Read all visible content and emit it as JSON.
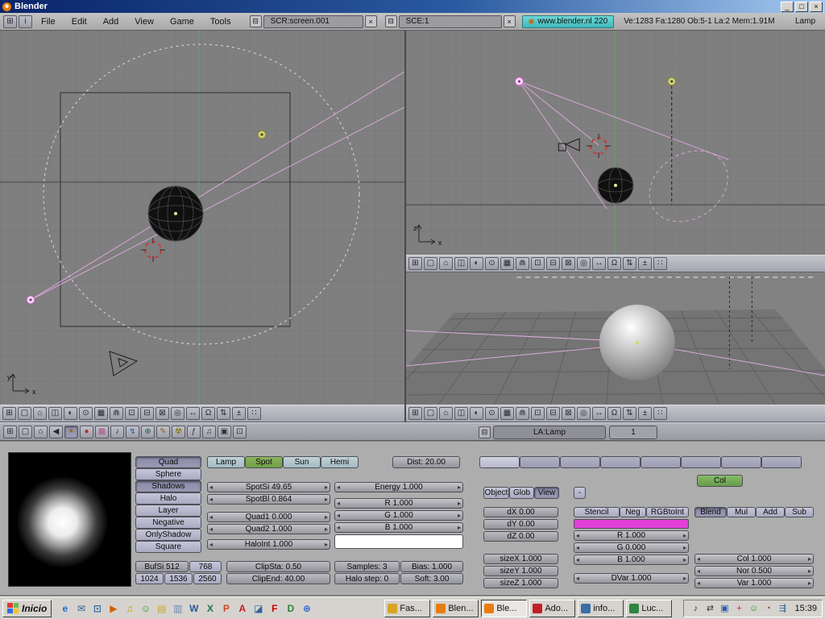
{
  "titlebar": {
    "title": "Blender"
  },
  "window_controls": {
    "minimize": "_",
    "maximize": "□",
    "close": "×"
  },
  "menubar": {
    "menus": [
      "File",
      "Edit",
      "Add",
      "View",
      "Game",
      "Tools"
    ],
    "collapse_glyph": "⊟",
    "screen_field": "SCR:screen.001",
    "scene_field": "SCE:1",
    "close_x": "×",
    "link_icon_glyph": "◉",
    "link_label": "www.blender.nl 220",
    "stats": "Ve:1283 Fa:1280 Ob:5-1 La:2 Mem:1.91M",
    "active_object": "Lamp"
  },
  "viewports": {
    "top_axis_v": "y",
    "top_axis_h": "x",
    "front_axis_v": "z",
    "front_axis_h": "x"
  },
  "buttons_header": {
    "lamp_name": "LA:Lamp",
    "number": "1"
  },
  "lamp_panel": {
    "toggles": [
      "Quad",
      "Sphere",
      "Shadows",
      "Halo",
      "Layer",
      "Negative",
      "OnlyShadow",
      "Square"
    ],
    "pressed_toggles": [
      "Quad",
      "Shadows"
    ],
    "bufsi_field": "BufSi 512",
    "bufsize_presets": [
      "768",
      "1024",
      "1536",
      "2560"
    ],
    "types": [
      "Lamp",
      "Spot",
      "Sun",
      "Hemi"
    ],
    "selected_type": "Spot",
    "dist_field": "Dist: 20.00",
    "spot_sliders": [
      "SpotSi 49.65",
      "SpotBl 0.864",
      "Quad1 0.000",
      "Quad2 1.000",
      "HaloInt 1.000"
    ],
    "clip_fields": [
      "ClipSta: 0.50",
      "ClipEnd: 40.00"
    ],
    "energy_sliders": [
      "Energy 1.000",
      "R 1.000",
      "G 1.000",
      "B 1.000"
    ],
    "lamp_color": "#ffffff",
    "shadow_fields": [
      "Samples: 3",
      "Bias: 1.000",
      "Halo step: 0",
      "Soft: 3.00"
    ]
  },
  "texture_panel": {
    "coord_buttons": [
      "Object",
      "Glob",
      "View"
    ],
    "selected_coord": "View",
    "minus_button": "-",
    "offset_fields": [
      "dX 0.00",
      "dY 0.00",
      "dZ 0.00"
    ],
    "size_fields": [
      "sizeX 1.000",
      "sizeY 1.000",
      "sizeZ 1.000"
    ],
    "option_buttons": [
      "Stencil",
      "Neg",
      "RGBtoInt"
    ],
    "texture_color": "#e23fd7",
    "rgb_sliders": [
      "R 1.000",
      "G 0.000",
      "B 1.000"
    ],
    "dvar_slider": "DVar 1.000",
    "col_button": "Col",
    "blend_buttons": [
      "Blend",
      "Mul",
      "Add",
      "Sub"
    ],
    "selected_blend": "Blend",
    "map_sliders": [
      "Col 1.000",
      "Nor 0.500",
      "Var 1.000"
    ]
  },
  "taskbar": {
    "start_label": "Inicio",
    "tasks": [
      {
        "label": "Fas...",
        "icon": "folder-icon",
        "color": "#d9a520"
      },
      {
        "label": "Blen...",
        "icon": "blender-icon",
        "color": "#e87d0d"
      },
      {
        "label": "Ble...",
        "icon": "blender-icon",
        "color": "#e87d0d",
        "active": true
      },
      {
        "label": "Ado...",
        "icon": "adobe-icon",
        "color": "#c01f25"
      },
      {
        "label": "info...",
        "icon": "document-icon",
        "color": "#3a6ea5"
      },
      {
        "label": "Luc...",
        "icon": "app-icon",
        "color": "#2e8540"
      }
    ],
    "clock": "15:39"
  },
  "icons": {
    "menubar_left": [
      {
        "name": "editor-type-icon",
        "glyph": "⊞"
      },
      {
        "name": "info-icon",
        "glyph": "i"
      }
    ],
    "viewport_header": [
      {
        "name": "editor-type-icon",
        "glyph": "⊞"
      },
      {
        "name": "fullscreen-icon",
        "glyph": "▢"
      },
      {
        "name": "home-icon",
        "glyph": "⌂"
      },
      {
        "name": "object-mode-icon",
        "glyph": "◫"
      },
      {
        "name": "draw-type-icon",
        "glyph": "◐"
      },
      {
        "name": "pivot-icon",
        "glyph": "⊙"
      },
      {
        "name": "layers-icon",
        "glyph": "▦"
      },
      {
        "name": "lock-icon",
        "glyph": "⋒"
      },
      {
        "name": "copy-attributes-icon",
        "glyph": "⊡"
      },
      {
        "name": "paste-attributes-icon",
        "glyph": "⊟"
      },
      {
        "name": "texture-face-icon",
        "glyph": "⊠"
      },
      {
        "name": "proportional-edit-icon",
        "glyph": "◎"
      },
      {
        "name": "pan-view-icon",
        "glyph": "↔"
      },
      {
        "name": "zoom-view-icon",
        "glyph": "Ω"
      },
      {
        "name": "aspect-icon",
        "glyph": "⇅"
      },
      {
        "name": "snap-icon",
        "glyph": "±"
      },
      {
        "name": "dots-icon",
        "glyph": "∷"
      }
    ],
    "buttons_header": [
      {
        "name": "editor-type-icon",
        "glyph": "⊞"
      },
      {
        "name": "fullscreen-icon",
        "glyph": "▢"
      },
      {
        "name": "home-icon",
        "glyph": "⌂"
      },
      {
        "name": "back-icon",
        "glyph": "◀"
      },
      {
        "name": "lamp-buttons-icon",
        "glyph": "☀",
        "color": "#8a6d00",
        "active": true
      },
      {
        "name": "material-buttons-icon",
        "glyph": "●",
        "color": "#b03030"
      },
      {
        "name": "texture-buttons-icon",
        "glyph": "▩",
        "color": "#b05890"
      },
      {
        "name": "animation-buttons-icon",
        "glyph": "♪",
        "color": "#303060"
      },
      {
        "name": "realtime-buttons-icon",
        "glyph": "↯",
        "color": "#2060a0"
      },
      {
        "name": "world-buttons-icon",
        "glyph": "⊕",
        "color": "#206040"
      },
      {
        "name": "paint-buttons-icon",
        "glyph": "✎",
        "color": "#806020"
      },
      {
        "name": "radiosity-buttons-icon",
        "glyph": "☢",
        "color": "#807000"
      },
      {
        "name": "script-buttons-icon",
        "glyph": "ƒ",
        "color": "#333333"
      },
      {
        "name": "sound-buttons-icon",
        "glyph": "♫",
        "color": "#333333"
      },
      {
        "name": "display-buttons-icon",
        "glyph": "▣",
        "color": "#333333"
      },
      {
        "name": "render-buttons-icon",
        "glyph": "⊡",
        "color": "#333333"
      }
    ],
    "quick_launch": [
      {
        "name": "internet-explorer-icon",
        "glyph": "e",
        "color": "#1b6acb"
      },
      {
        "name": "outlook-icon",
        "glyph": "✉",
        "color": "#355d9e"
      },
      {
        "name": "show-desktop-icon",
        "glyph": "⊡",
        "color": "#3a6ea5"
      },
      {
        "name": "media-player-icon",
        "glyph": "▶",
        "color": "#d06000"
      },
      {
        "name": "winamp-icon",
        "glyph": "♫",
        "color": "#c8a000"
      },
      {
        "name": "messenger-icon",
        "glyph": "☺",
        "color": "#2aa02a"
      },
      {
        "name": "folder-icon",
        "glyph": "▤",
        "color": "#c8a832"
      },
      {
        "name": "notepad-icon",
        "glyph": "▥",
        "color": "#6a8ab0"
      },
      {
        "name": "word-icon",
        "glyph": "W",
        "color": "#2b579a"
      },
      {
        "name": "excel-icon",
        "glyph": "X",
        "color": "#217346"
      },
      {
        "name": "powerpoint-icon",
        "glyph": "P",
        "color": "#d24726"
      },
      {
        "name": "acrobat-icon",
        "glyph": "A",
        "color": "#c01f25"
      },
      {
        "name": "photoshop-icon",
        "glyph": "◪",
        "color": "#31639c"
      },
      {
        "name": "flash-icon",
        "glyph": "F",
        "color": "#cc0000"
      },
      {
        "name": "dreamweaver-icon",
        "glyph": "D",
        "color": "#2e8540"
      },
      {
        "name": "browser-icon",
        "glyph": "⊕",
        "color": "#3366cc"
      }
    ],
    "tray": [
      {
        "name": "volume-icon",
        "glyph": "♪",
        "color": "#333333"
      },
      {
        "name": "network-icon",
        "glyph": "⇄",
        "color": "#333333"
      },
      {
        "name": "display-settings-icon",
        "glyph": "▣",
        "color": "#2a5caa"
      },
      {
        "name": "antivirus-icon",
        "glyph": "+",
        "color": "#cc2222"
      },
      {
        "name": "messenger-tray-icon",
        "glyph": "☺",
        "color": "#2a8a2a"
      },
      {
        "name": "scheduler-icon",
        "glyph": "◔",
        "color": "#555555"
      },
      {
        "name": "usb-icon",
        "glyph": "⇶",
        "color": "#336699"
      }
    ]
  }
}
